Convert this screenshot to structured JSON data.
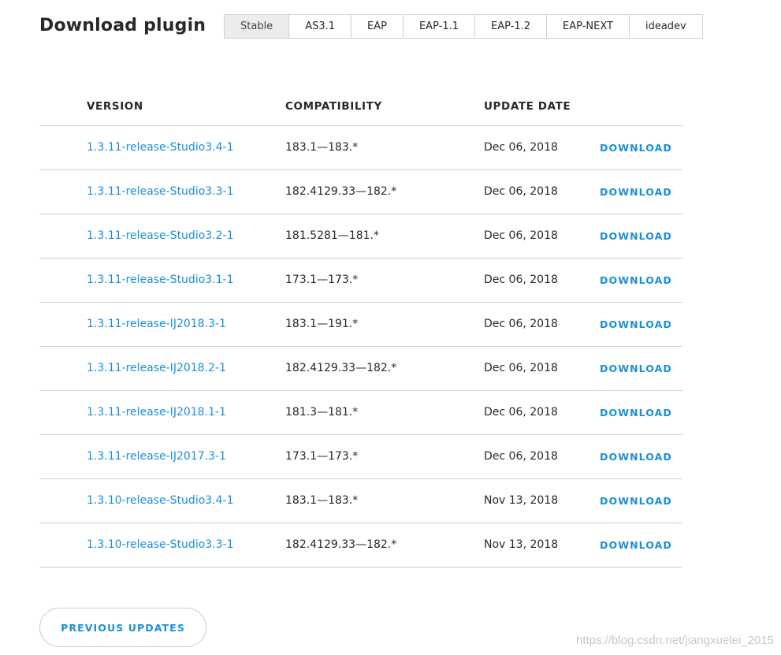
{
  "header": {
    "title": "Download plugin"
  },
  "tabs": [
    {
      "label": "Stable",
      "active": true
    },
    {
      "label": "AS3.1",
      "active": false
    },
    {
      "label": "EAP",
      "active": false
    },
    {
      "label": "EAP-1.1",
      "active": false
    },
    {
      "label": "EAP-1.2",
      "active": false
    },
    {
      "label": "EAP-NEXT",
      "active": false
    },
    {
      "label": "ideadev",
      "active": false
    }
  ],
  "table": {
    "headers": {
      "version": "VERSION",
      "compatibility": "COMPATIBILITY",
      "update_date": "UPDATE DATE"
    },
    "download_label": "DOWNLOAD",
    "rows": [
      {
        "version": "1.3.11-release-Studio3.4-1",
        "compatibility": "183.1—183.*",
        "date": "Dec 06, 2018"
      },
      {
        "version": "1.3.11-release-Studio3.3-1",
        "compatibility": "182.4129.33—182.*",
        "date": "Dec 06, 2018"
      },
      {
        "version": "1.3.11-release-Studio3.2-1",
        "compatibility": "181.5281—181.*",
        "date": "Dec 06, 2018"
      },
      {
        "version": "1.3.11-release-Studio3.1-1",
        "compatibility": "173.1—173.*",
        "date": "Dec 06, 2018"
      },
      {
        "version": "1.3.11-release-IJ2018.3-1",
        "compatibility": "183.1—191.*",
        "date": "Dec 06, 2018"
      },
      {
        "version": "1.3.11-release-IJ2018.2-1",
        "compatibility": "182.4129.33—182.*",
        "date": "Dec 06, 2018"
      },
      {
        "version": "1.3.11-release-IJ2018.1-1",
        "compatibility": "181.3—181.*",
        "date": "Dec 06, 2018"
      },
      {
        "version": "1.3.11-release-IJ2017.3-1",
        "compatibility": "173.1—173.*",
        "date": "Dec 06, 2018"
      },
      {
        "version": "1.3.10-release-Studio3.4-1",
        "compatibility": "183.1—183.*",
        "date": "Nov 13, 2018"
      },
      {
        "version": "1.3.10-release-Studio3.3-1",
        "compatibility": "182.4129.33—182.*",
        "date": "Nov 13, 2018"
      }
    ]
  },
  "footer": {
    "previous_updates_label": "PREVIOUS UPDATES"
  },
  "watermark": "https://blog.csdn.net/jiangxuelei_2015",
  "colors": {
    "link": "#1b8fd5",
    "text": "#27282c",
    "border": "#d1d1d2",
    "active_tab_bg": "#ececec"
  }
}
